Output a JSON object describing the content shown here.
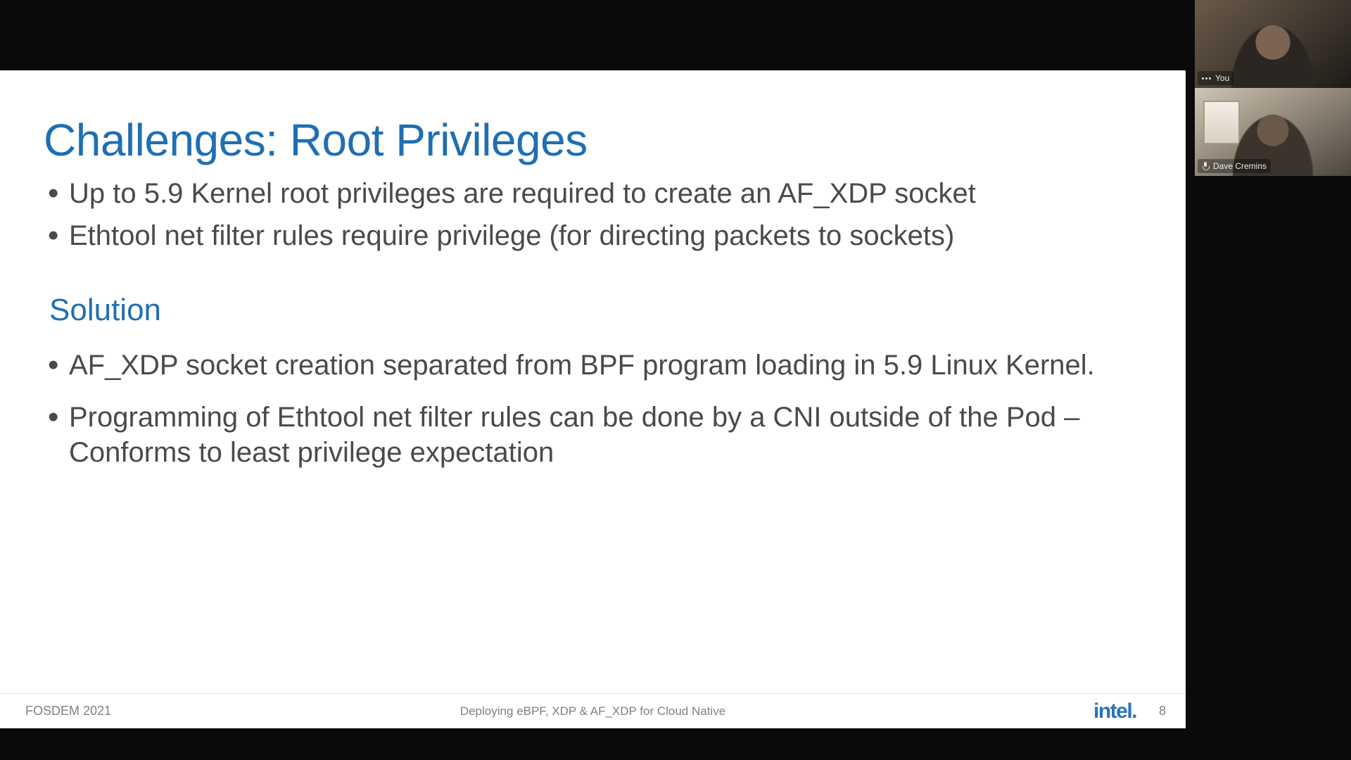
{
  "slide": {
    "title": "Challenges: Root Privileges",
    "bullets_top": [
      "Up to 5.9 Kernel root privileges are required to create an AF_XDP socket",
      "Ethtool net filter rules require privilege (for directing packets to sockets)"
    ],
    "subheading": "Solution",
    "bullets_solution": [
      "AF_XDP socket creation separated from BPF program loading in 5.9 Linux Kernel.",
      "Programming of Ethtool net filter rules can be done by a CNI outside of the Pod – Conforms to least privilege expectation"
    ],
    "footer": {
      "left": "FOSDEM 2021",
      "center": "Deploying eBPF, XDP & AF_XDP for Cloud Native",
      "logo": "intel.",
      "page": "8"
    }
  },
  "participants": [
    {
      "label": "You",
      "show_dots": true
    },
    {
      "label": "Dave Cremins",
      "show_mic": true
    }
  ]
}
